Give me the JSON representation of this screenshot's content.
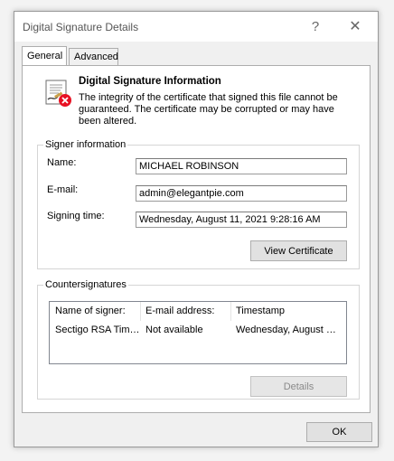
{
  "window": {
    "title": "Digital Signature Details",
    "help_glyph": "?",
    "close_glyph": "✕"
  },
  "tabs": [
    {
      "label": "General",
      "active": true
    },
    {
      "label": "Advanced",
      "active": false
    }
  ],
  "info": {
    "title": "Digital Signature Information",
    "text": "The integrity of the certificate that signed this file cannot be guaranteed. The certificate may be corrupted or may have been altered.",
    "icon": "certificate-error-icon"
  },
  "signer": {
    "legend": "Signer information",
    "name_label": "Name:",
    "name_value": "MICHAEL ROBINSON",
    "email_label": "E-mail:",
    "email_value": "admin@elegantpie.com",
    "time_label": "Signing time:",
    "time_value": "Wednesday, August 11, 2021 9:28:16 AM",
    "view_cert_label": "View Certificate"
  },
  "countersignatures": {
    "legend": "Countersignatures",
    "columns": [
      "Name of signer:",
      "E-mail address:",
      "Timestamp"
    ],
    "rows": [
      [
        "Sectigo RSA Tim…",
        "Not available",
        "Wednesday, August …"
      ]
    ],
    "details_label": "Details"
  },
  "footer": {
    "ok_label": "OK"
  },
  "colors": {
    "error_red": "#e81123",
    "window_bg": "#f0f0f0"
  }
}
